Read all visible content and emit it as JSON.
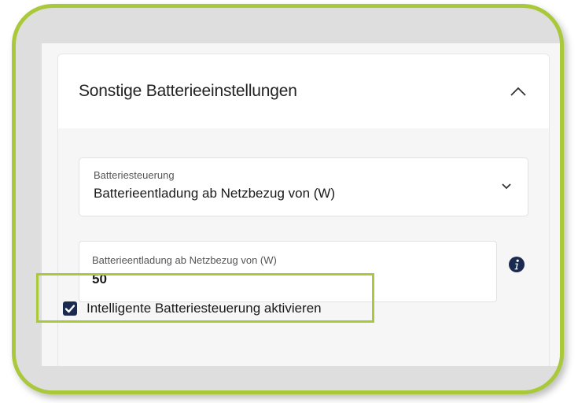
{
  "panel": {
    "title": "Sonstige Batterieeinstellungen",
    "collapse_icon": "chevron-up-icon"
  },
  "battery_control": {
    "label": "Batteriesteuerung",
    "value": "Batterieentladung ab Netzbezug von (W)",
    "dropdown_icon": "chevron-down-icon"
  },
  "discharge_field": {
    "label": "Batterieentladung ab Netzbezug von (W)",
    "value": "50",
    "info_icon": "info-icon"
  },
  "smart_control": {
    "label": "Intelligente Batteriesteuerung aktivieren",
    "checked": true
  },
  "colors": {
    "highlight": "#a9c93a",
    "checkbox": "#1b2b50",
    "info": "#1b2b50"
  }
}
